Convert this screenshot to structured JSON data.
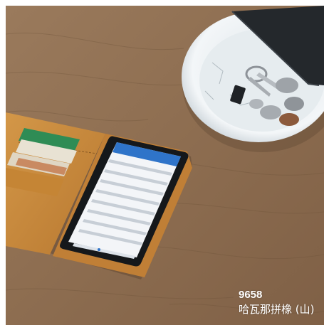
{
  "photo": {
    "subject": "leather-flip-wallet-phone-case-on-wood-table"
  },
  "caption": {
    "code": "9658",
    "name": "哈瓦那拼橡 (山)"
  },
  "colors": {
    "wood": "#8f6f52",
    "wood_dark": "#6f533b",
    "leather": "#c98a3e",
    "dish": "#eef1f3",
    "wallet": "#24282c",
    "screen": "#f3f5f8",
    "app_header": "#2f74c9"
  }
}
